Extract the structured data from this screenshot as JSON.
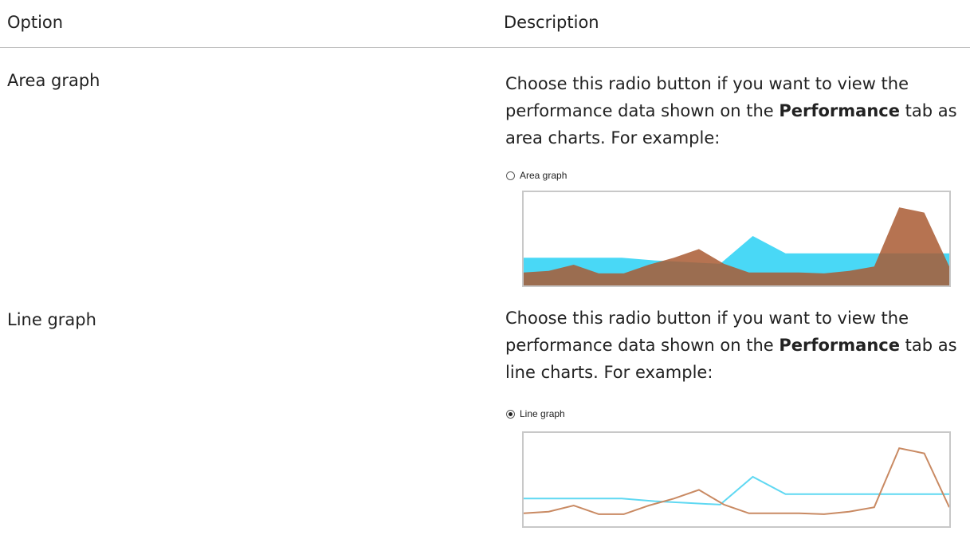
{
  "header": {
    "option": "Option",
    "description": "Description"
  },
  "rows": [
    {
      "option": "Area graph",
      "desc_before": "Choose this radio button if you want to view the performance data shown on the ",
      "desc_bold": "Performance",
      "desc_after": " tab as area charts. For example:",
      "radio_label": "Area graph",
      "radio_checked": false
    },
    {
      "option": "Line graph",
      "desc_before": "Choose this radio button if you want to view the performance data shown on the ",
      "desc_bold": "Performance",
      "desc_after": " tab as line charts. For example:",
      "radio_label": "Line graph",
      "radio_checked": true
    }
  ],
  "chart_data": [
    {
      "type": "area",
      "series": [
        {
          "color": "#3fd6f5",
          "values": [
            30,
            30,
            30,
            30,
            27,
            25,
            23,
            55,
            35,
            35,
            35,
            35,
            35,
            35
          ]
        },
        {
          "color": "#a95b33",
          "values": [
            13,
            15,
            22,
            12,
            12,
            22,
            30,
            40,
            23,
            13,
            13,
            13,
            12,
            15,
            20,
            88,
            82,
            20
          ]
        }
      ],
      "ylim": [
        0,
        100
      ]
    },
    {
      "type": "line",
      "series": [
        {
          "color": "#5fd8f2",
          "values": [
            30,
            30,
            30,
            30,
            27,
            25,
            23,
            55,
            35,
            35,
            35,
            35,
            35,
            35
          ]
        },
        {
          "color": "#c98a63",
          "values": [
            13,
            15,
            22,
            12,
            12,
            22,
            30,
            40,
            23,
            13,
            13,
            13,
            12,
            15,
            20,
            88,
            82,
            20
          ]
        }
      ],
      "ylim": [
        0,
        100
      ]
    }
  ]
}
